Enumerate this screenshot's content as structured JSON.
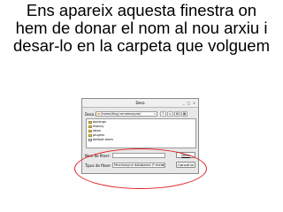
{
  "slide": {
    "title_lines": [
      "Ens apareix aquesta finestra on",
      "hem de donar el nom al nou arxiu i",
      "desar-lo en la carpeta que volguem"
    ]
  },
  "dialog": {
    "title": "Desa",
    "minimize_glyph": "_",
    "maximize_glyph": "□",
    "close_glyph": "×",
    "location_label": "Desa a:",
    "location_path": "/home/ting/.mnemosyne/",
    "nav_buttons": [
      "↑",
      "⌂",
      "▤",
      "▦"
    ],
    "files": [
      {
        "name": "backups",
        "type": "folder"
      },
      {
        "name": "history",
        "type": "folder"
      },
      {
        "name": "latex",
        "type": "folder"
      },
      {
        "name": "plugins",
        "type": "folder"
      },
      {
        "name": "default.mem",
        "type": "file"
      }
    ],
    "filename_label": "Nom de fitxer:",
    "filename_value": "",
    "filetype_label": "Tipus de fitxer:",
    "filetype_value": "Mnemosyne databases (*.mem)",
    "save_button": "Desa",
    "cancel_button": "Cancel·la"
  },
  "accent_colors": {
    "highlight_ellipse": "#e02020",
    "folder": "#e2c25a"
  }
}
